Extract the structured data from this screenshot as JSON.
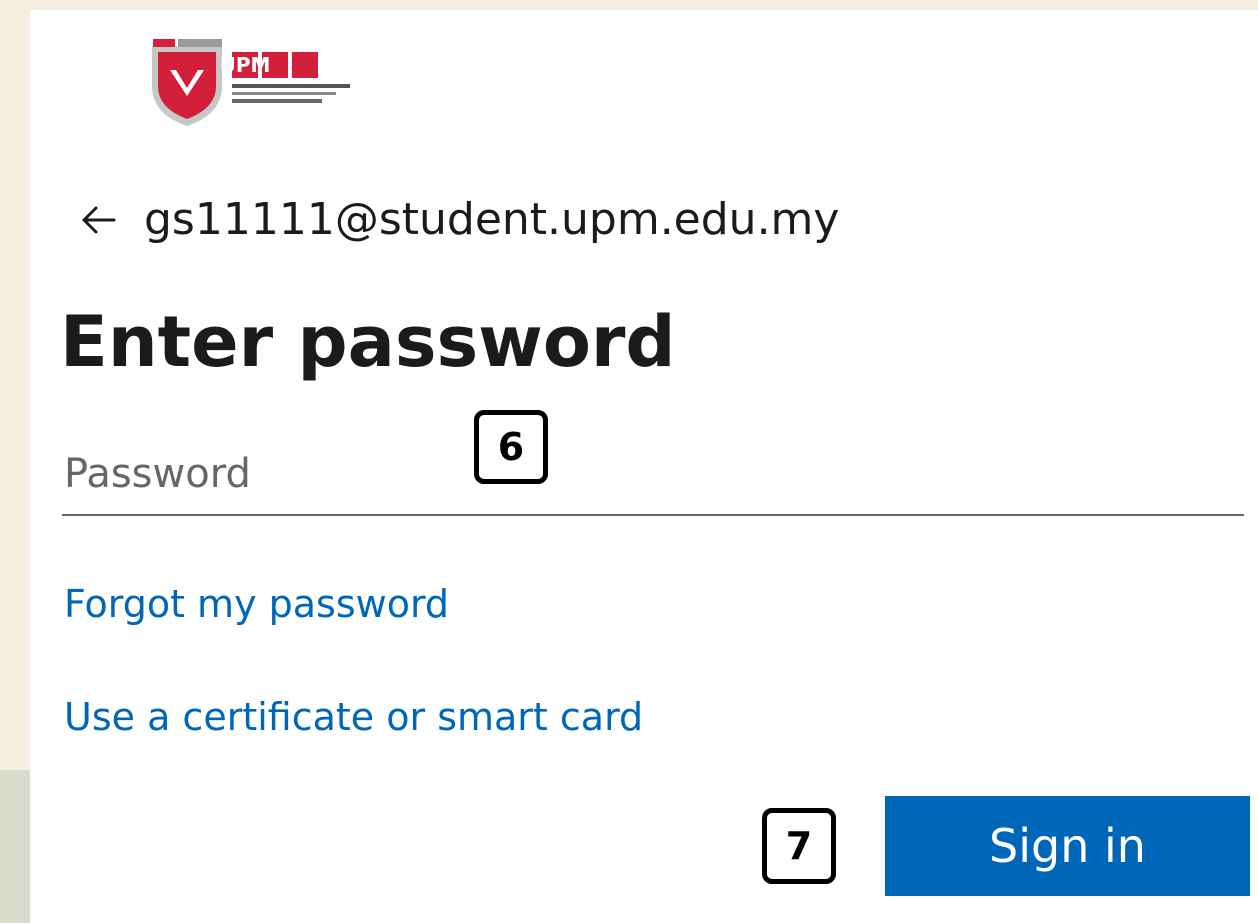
{
  "brand": {
    "logo_text": "UPM",
    "logo_icon": "upm-shield-logo",
    "primary_color": "#0067b8",
    "logo_red": "#d21f3a"
  },
  "identity": {
    "back_icon": "back-arrow-icon",
    "email": "gs11111@student.upm.edu.my"
  },
  "header": {
    "title": "Enter password"
  },
  "password_field": {
    "placeholder": "Password",
    "value": ""
  },
  "links": {
    "forgot": "Forgot my password",
    "certificate": "Use a certificate or smart card"
  },
  "actions": {
    "sign_in_label": "Sign in"
  },
  "annotations": {
    "step_password": "6",
    "step_sign_in": "7"
  }
}
